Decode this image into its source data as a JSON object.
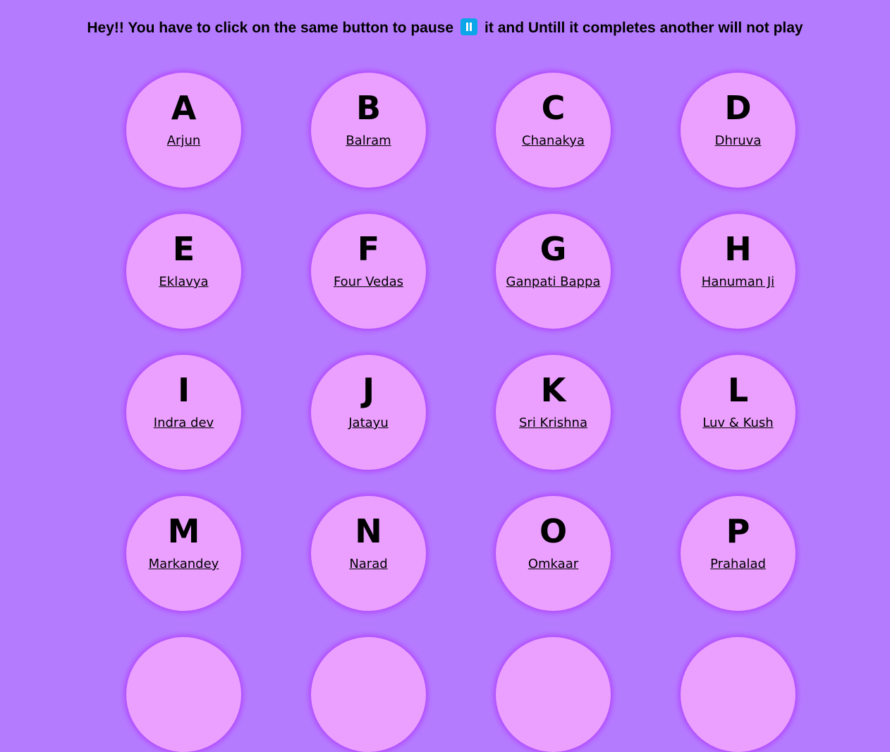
{
  "header": {
    "text_before": "Hey!! You have to click on the same button to pause",
    "pause_icon": "pause-icon",
    "text_after": "it and Untill it completes another will not play"
  },
  "colors": {
    "background": "#b57bff",
    "button": "#eba0ff",
    "button_glow": "#b13cff",
    "pause_icon": "#0aa6e8"
  },
  "buttons": [
    {
      "letter": "A",
      "name": "Arjun"
    },
    {
      "letter": "B",
      "name": "Balram"
    },
    {
      "letter": "C",
      "name": "Chanakya"
    },
    {
      "letter": "D",
      "name": "Dhruva"
    },
    {
      "letter": "E",
      "name": "Eklavya"
    },
    {
      "letter": "F",
      "name": "Four Vedas"
    },
    {
      "letter": "G",
      "name": "Ganpati Bappa"
    },
    {
      "letter": "H",
      "name": "Hanuman Ji"
    },
    {
      "letter": "I",
      "name": "Indra dev"
    },
    {
      "letter": "J",
      "name": "Jatayu"
    },
    {
      "letter": "K",
      "name": "Sri Krishna"
    },
    {
      "letter": "L",
      "name": "Luv & Kush"
    },
    {
      "letter": "M",
      "name": "Markandey"
    },
    {
      "letter": "N",
      "name": "Narad"
    },
    {
      "letter": "O",
      "name": "Omkaar"
    },
    {
      "letter": "P",
      "name": "Prahalad"
    }
  ]
}
